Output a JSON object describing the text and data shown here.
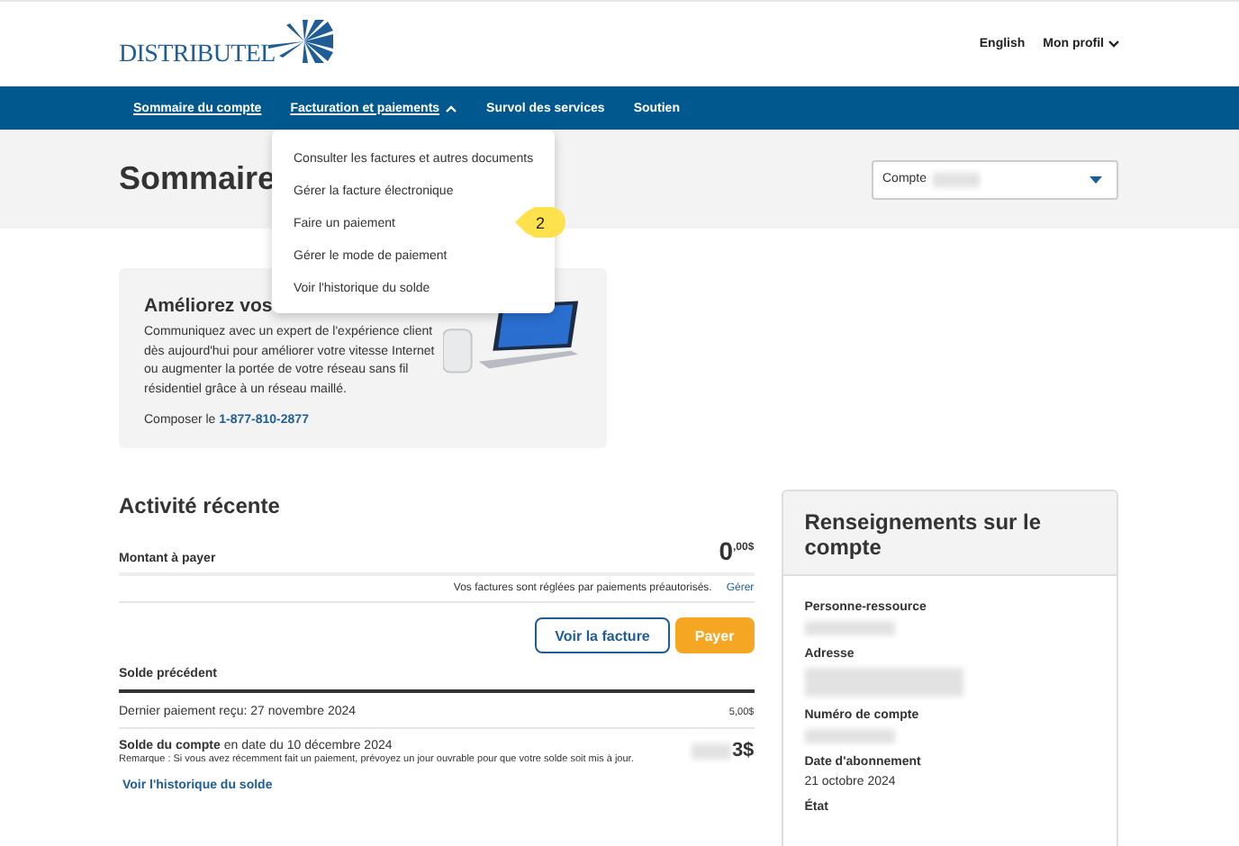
{
  "header": {
    "logo": "DISTRIBUTEL",
    "links": [
      {
        "label": "English",
        "has_caret": false
      },
      {
        "label": "Mon profil",
        "has_caret": true
      }
    ]
  },
  "nav": {
    "items": [
      {
        "label": "Sommaire du compte",
        "underlined": true,
        "has_caret": false
      },
      {
        "label": "Facturation et paiements",
        "underlined": true,
        "has_caret": true,
        "expanded": true
      },
      {
        "label": "Survol des services",
        "underlined": false,
        "has_caret": false
      },
      {
        "label": "Soutien",
        "underlined": false,
        "has_caret": false
      }
    ]
  },
  "dropdown": {
    "items": [
      {
        "label": "Consulter les factures et autres documents"
      },
      {
        "label": "Gérer la facture électronique"
      },
      {
        "label": "Faire un paiement",
        "callout": "2"
      },
      {
        "label": "Gérer le mode de paiement"
      },
      {
        "label": "Voir l'historique du solde"
      }
    ]
  },
  "page_title": "Sommaire",
  "account_select": {
    "label": "Compte"
  },
  "promo": {
    "title": "Améliorez vos",
    "body": "Communiquez avec un expert de l'expérience client dès aujourd'hui pour améliorer votre vitesse Internet ou augmenter la portée de votre réseau sans fil résidentiel grâce à un réseau maillé.",
    "phone_label": "Composer le",
    "phone": "1-877-810-2877"
  },
  "activity": {
    "title": "Activité récente",
    "amount_label": "Montant à payer",
    "amount_whole": "0",
    "amount_fraction": ",00$",
    "autopay_note": "Vos factures sont réglées par paiements préautorisés.",
    "manage_link": "Gérer",
    "buttons": [
      {
        "label": "Voir la facture",
        "kind": "outline"
      },
      {
        "label": "Payer",
        "kind": "primary"
      }
    ],
    "previous_balance_label": "Solde précédent",
    "last_payment": "Dernier paiement reçu: 27 novembre 2024",
    "last_payment_amount": "5,00$",
    "balance_label": "Solde du compte",
    "balance_date": "en date du 10 décembre 2024",
    "balance_note": "Remarque : Si vous avez récemment fait un paiement, prévoyez un jour ouvrable pour que votre solde soit mis à jour.",
    "balance_amount": "3$",
    "history_link": "Voir l'historique du solde"
  },
  "account_info": {
    "title": "Renseignements sur le compte",
    "fields": [
      {
        "label": "Personne-ressource"
      },
      {
        "label": "Adresse"
      },
      {
        "label": "Numéro de compte"
      },
      {
        "label": "Date d'abonnement",
        "value": "21 octobre 2024"
      },
      {
        "label": "État"
      }
    ]
  }
}
